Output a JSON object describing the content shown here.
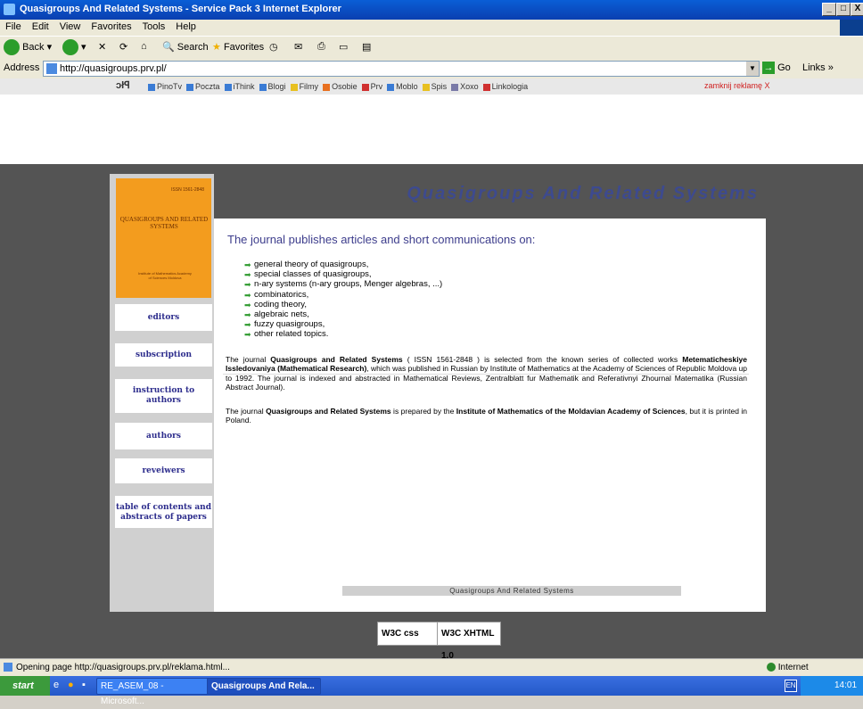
{
  "window": {
    "title": "Quasigroups And Related Systems - Service Pack 3 Internet Explorer",
    "min_label": "_",
    "max_label": "□",
    "close_label": "X"
  },
  "menu": [
    "File",
    "Edit",
    "View",
    "Favorites",
    "Tools",
    "Help"
  ],
  "toolbar": {
    "back": "Back",
    "search": "Search",
    "favorites": "Favorites"
  },
  "address": {
    "label": "Address",
    "url": "http://quasigroups.prv.pl/",
    "go": "Go",
    "links": "Links"
  },
  "linksbar": {
    "logo": "ɔłꟼ",
    "items": [
      {
        "label": "PinoTv",
        "color": "#3a7bd5"
      },
      {
        "label": "Poczta",
        "color": "#3a7bd5"
      },
      {
        "label": "iThink",
        "color": "#3a7bd5"
      },
      {
        "label": "Blogi",
        "color": "#3a7bd5"
      },
      {
        "label": "Filmy",
        "color": "#e8c020"
      },
      {
        "label": "Osobie",
        "color": "#e87020"
      },
      {
        "label": "Prv",
        "color": "#d03030"
      },
      {
        "label": "Moblo",
        "color": "#3a7bd5"
      },
      {
        "label": "Spis",
        "color": "#e8c020"
      },
      {
        "label": "Xoxo",
        "color": "#7a7aa8"
      },
      {
        "label": "Linkologia",
        "color": "#d03030"
      }
    ],
    "close_ad": "zamknij reklamę X"
  },
  "cover": {
    "issn": "ISSN 1561-2848",
    "title": "QUASIGROUPS AND RELATED SYSTEMS",
    "publisher": "Institute of Mathematics Academy of Sciences Moldova"
  },
  "nav": [
    {
      "label": "editors"
    },
    {
      "label": "subscription"
    },
    {
      "label": "instruction to authors"
    },
    {
      "label": "authors"
    },
    {
      "label": "reveiwers"
    },
    {
      "label": "table of contents and abstracts of papers"
    }
  ],
  "header": {
    "title": "Quasigroups And Related Systems"
  },
  "main": {
    "lead": "The journal publishes articles and short communications on:",
    "topics": [
      "general theory of quasigroups,",
      "special classes of quasigroups,",
      "n-ary systems (n-ary groups, Menger algebras, ...)",
      "combinatorics,",
      "coding theory,",
      "algebraic nets,",
      "fuzzy quasigroups,",
      "other related topics."
    ],
    "para1": {
      "a": "The journal ",
      "b": "Quasigroups and Related Systems",
      "c": " ( ISSN 1561-2848 ) is selected from the known series of collected works ",
      "d": "Metematicheskiye Issledovaniya (Mathematical Research)",
      "e": ", which was published in Russian by Institute of Mathematics at the Academy of Sciences of Republic Moldova up to 1992. The journal is indexed and abstracted in Mathematical Reviews, Zentralblatt fur Mathematik and Referativnyi Zhournal Matematika (Russian Abstract Journal)."
    },
    "para2": {
      "a": "The journal ",
      "b": "Quasigroups and Related Systems",
      "c": " is prepared by the ",
      "d": "Institute of Mathematics of the Moldavian Academy of Sciences",
      "e": ", but it is printed in Poland."
    },
    "footer": "Quasigroups And Related Systems"
  },
  "badges": {
    "css": "W3C css",
    "xhtml": "W3C XHTML 1.0"
  },
  "status": {
    "text": "Opening page http://quasigroups.prv.pl/reklama.html...",
    "zone": "Internet"
  },
  "taskbar": {
    "start": "start",
    "tasks": [
      "RE_ASEM_08 - Microsoft...",
      "Quasigroups And Rela..."
    ],
    "lang": "EN",
    "clock": "14:01"
  }
}
